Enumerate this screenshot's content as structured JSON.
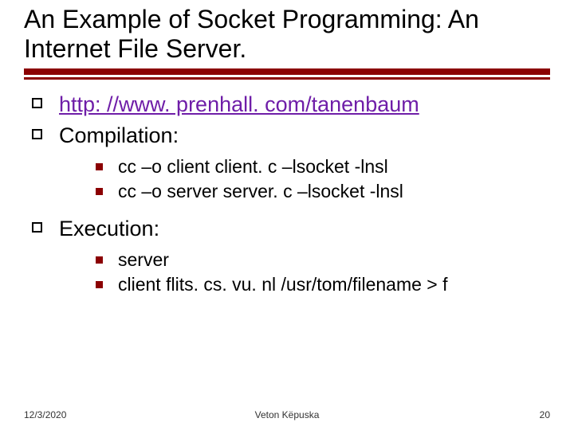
{
  "title": "An Example of Socket Programming: An Internet File Server.",
  "body": {
    "link_text": "http: //www. prenhall. com/tanenbaum",
    "link_href": "http://www.prenhall.com/tanenbaum",
    "compilation_label": "Compilation:",
    "compilation_items": [
      "cc –o client client. c –lsocket -lnsl",
      "cc –o server server. c –lsocket -lnsl"
    ],
    "execution_label": "Execution:",
    "execution_items": [
      "server",
      "client flits. cs. vu. nl /usr/tom/filename > f"
    ]
  },
  "footer": {
    "date": "12/3/2020",
    "author": "Veton Këpuska",
    "page": "20"
  },
  "colors": {
    "accent": "#8b0002",
    "link": "#6f1ea8"
  }
}
